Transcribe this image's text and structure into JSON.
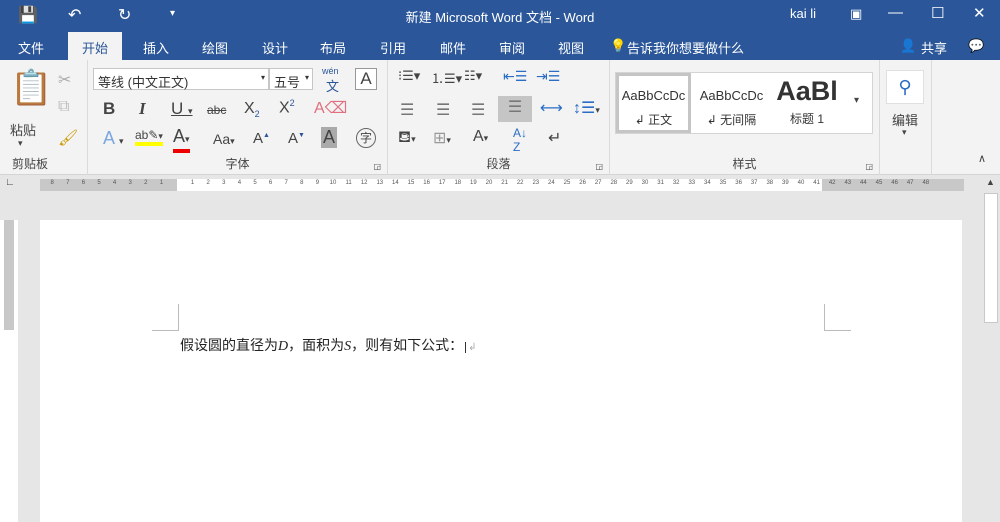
{
  "title": "新建 Microsoft Word 文档  -  Word",
  "user": "kai li",
  "tabs": [
    "文件",
    "开始",
    "插入",
    "绘图",
    "设计",
    "布局",
    "引用",
    "邮件",
    "审阅",
    "视图"
  ],
  "tell_me": "告诉我你想要做什么",
  "share": "共享",
  "clipboard": {
    "paste": "粘贴",
    "label": "剪贴板"
  },
  "font": {
    "name": "等线 (中文正文)",
    "size": "五号",
    "label": "字体",
    "wen": "wén",
    "wen_char": "文"
  },
  "paragraph": {
    "label": "段落"
  },
  "styles": {
    "label": "样式",
    "items": [
      {
        "preview": "AaBbCcDc",
        "name": "↲ 正文"
      },
      {
        "preview": "AaBbCcDc",
        "name": "↲ 无间隔"
      },
      {
        "preview": "AaBl",
        "name": "标题 1"
      }
    ]
  },
  "editing": {
    "label": "编辑"
  },
  "ruler": {
    "left": [
      "8",
      "7",
      "6",
      "5",
      "4",
      "3",
      "2",
      "1"
    ],
    "main": [
      "1",
      "2",
      "3",
      "4",
      "5",
      "6",
      "7",
      "8",
      "9",
      "10",
      "11",
      "12",
      "13",
      "14",
      "15",
      "16",
      "17",
      "18",
      "19",
      "20",
      "21",
      "22",
      "23",
      "24",
      "25",
      "26",
      "27",
      "28",
      "29",
      "30",
      "31",
      "32",
      "33",
      "34",
      "35",
      "36",
      "37",
      "38",
      "39"
    ],
    "right": [
      "40",
      "41",
      "42",
      "43",
      "44",
      "45",
      "46",
      "47",
      "48"
    ]
  },
  "doc": {
    "t1": "假设圆的直径为",
    "v1": "D",
    "t2": "，面积为",
    "v2": "S",
    "t3": "，则有如下公式：",
    "mark": "↲"
  }
}
